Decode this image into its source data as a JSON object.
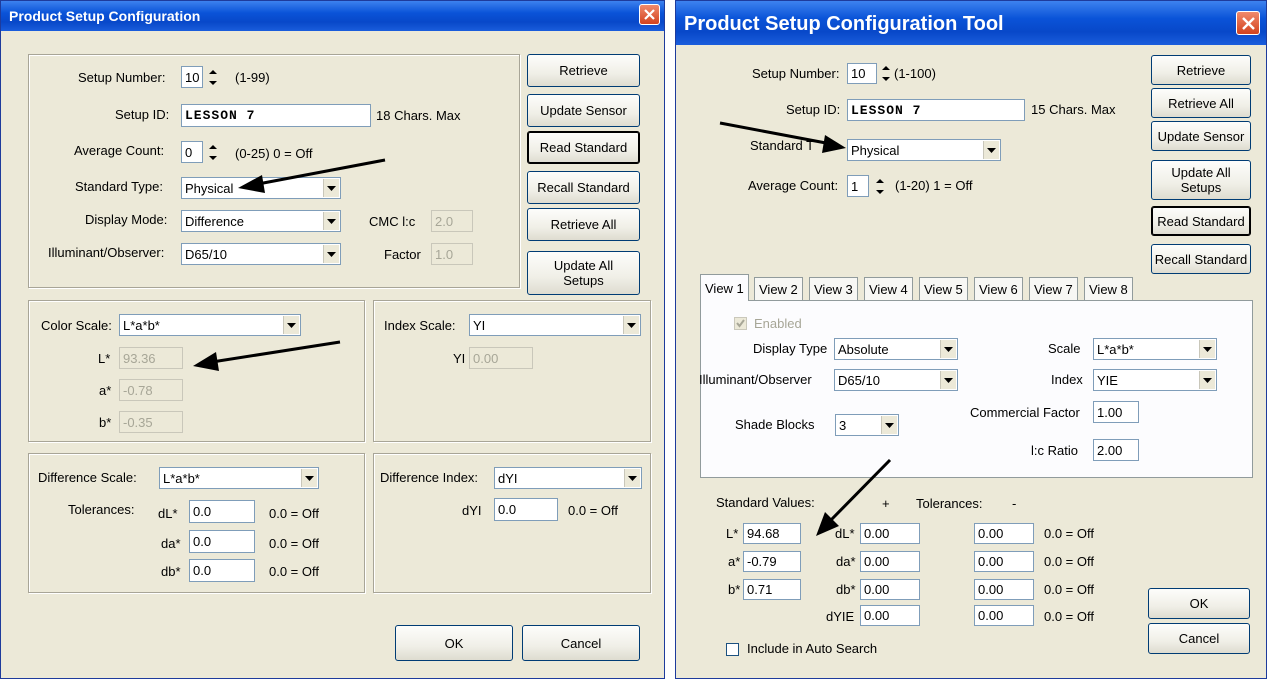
{
  "left": {
    "title": "Product Setup Configuration",
    "setup_number_label": "Setup Number:",
    "setup_number_value": "10",
    "setup_number_range": "(1-99)",
    "setup_id_label": "Setup ID:",
    "setup_id_value": "LESSON 7",
    "setup_id_hint": "18 Chars. Max",
    "average_count_label": "Average Count:",
    "average_count_value": "0",
    "average_count_hint": "(0-25) 0 = Off",
    "standard_type_label": "Standard Type:",
    "standard_type_value": "Physical",
    "display_mode_label": "Display Mode:",
    "display_mode_value": "Difference",
    "cmc_label": "CMC l:c",
    "cmc_value": "2.0",
    "illum_label": "Illuminant/Observer:",
    "illum_value": "D65/10",
    "factor_label": "Factor",
    "factor_value": "1.0",
    "buttons": {
      "retrieve": "Retrieve",
      "update_sensor": "Update Sensor",
      "read_standard": "Read Standard",
      "recall_standard": "Recall Standard",
      "retrieve_all": "Retrieve All",
      "update_all_1": "Update All",
      "update_all_2": "Setups",
      "ok": "OK",
      "cancel": "Cancel"
    },
    "color_scale_label": "Color Scale:",
    "color_scale_value": "L*a*b*",
    "l_label": "L*",
    "l_value": "93.36",
    "a_label": "a*",
    "a_value": "-0.78",
    "b_label": "b*",
    "b_value": "-0.35",
    "index_scale_label": "Index Scale:",
    "index_scale_value": "YI",
    "yi_label": "YI",
    "yi_value": "0.00",
    "diff_scale_label": "Difference Scale:",
    "diff_scale_value": "L*a*b*",
    "tolerances_label": "Tolerances:",
    "dl_label": "dL*",
    "dl_value": "0.0",
    "dl_hint": "0.0 = Off",
    "da_label": "da*",
    "da_value": "0.0",
    "da_hint": "0.0 = Off",
    "db_label": "db*",
    "db_value": "0.0",
    "db_hint": "0.0 = Off",
    "diff_index_label": "Difference Index:",
    "diff_index_value": "dYI",
    "dyi_label": "dYI",
    "dyi_value": "0.0",
    "dyi_hint": "0.0 = Off"
  },
  "right": {
    "title": "Product Setup Configuration Tool",
    "setup_number_label": "Setup Number:",
    "setup_number_value": "10",
    "setup_number_range": "(1-100)",
    "setup_id_label": "Setup ID:",
    "setup_id_value": "LESSON 7",
    "setup_id_hint": "15 Chars. Max",
    "standard_type_label": "Standard T",
    "standard_type_value": "Physical",
    "average_count_label": "Average Count:",
    "average_count_value": "1",
    "average_count_hint": "(1-20) 1 = Off",
    "buttons": {
      "retrieve": "Retrieve",
      "retrieve_all": "Retrieve All",
      "update_sensor": "Update Sensor",
      "update_all_1": "Update All",
      "update_all_2": "Setups",
      "read_standard": "Read Standard",
      "recall_standard": "Recall Standard",
      "ok": "OK",
      "cancel": "Cancel"
    },
    "tabs": [
      "View 1",
      "View 2",
      "View 3",
      "View 4",
      "View 5",
      "View 6",
      "View 7",
      "View 8"
    ],
    "enabled_label": "Enabled",
    "display_type_label": "Display Type",
    "display_type_value": "Absolute",
    "scale_label": "Scale",
    "scale_value": "L*a*b*",
    "illum_label": "Illuminant/Observer",
    "illum_value": "D65/10",
    "index_label": "Index",
    "index_value": "YIE",
    "commercial_factor_label": "Commercial Factor",
    "commercial_factor_value": "1.00",
    "shade_blocks_label": "Shade Blocks",
    "shade_blocks_value": "3",
    "lc_ratio_label": "l:c Ratio",
    "lc_ratio_value": "2.00",
    "standard_values_label": "Standard Values:",
    "plus_label": "+",
    "tolerances_label": "Tolerances:",
    "minus_label": "-",
    "std_rows": [
      {
        "label": "L*",
        "value": "94.68"
      },
      {
        "label": "a*",
        "value": "-0.79"
      },
      {
        "label": "b*",
        "value": "0.71"
      }
    ],
    "tol_rows": [
      {
        "label": "dL*",
        "plus": "0.00",
        "minus": "0.00",
        "hint": "0.0 = Off"
      },
      {
        "label": "da*",
        "plus": "0.00",
        "minus": "0.00",
        "hint": "0.0 = Off"
      },
      {
        "label": "db*",
        "plus": "0.00",
        "minus": "0.00",
        "hint": "0.0 = Off"
      },
      {
        "label": "dYIE",
        "plus": "0.00",
        "minus": "0.00",
        "hint": "0.0 = Off"
      }
    ],
    "auto_search_label": "Include in Auto Search"
  }
}
